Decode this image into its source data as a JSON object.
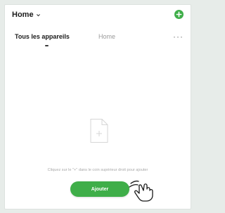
{
  "header": {
    "home_label": "Home",
    "dropdown_icon": "chevron-down-icon",
    "add_icon": "plus-circle-icon"
  },
  "tabs": [
    {
      "label": "Tous les appareils",
      "active": true
    },
    {
      "label": "Home",
      "active": false
    }
  ],
  "more_icon": "more-dots-icon",
  "more_label": "···",
  "empty_state": {
    "icon": "document-add-icon",
    "message": "Cliquez sur le \"+\" dans le coin supérieur droit pour ajouter",
    "button_label": "Ajouter"
  },
  "colors": {
    "accent": "#3fae49",
    "background": "#ffffff",
    "muted_text": "#a8a8a8"
  }
}
